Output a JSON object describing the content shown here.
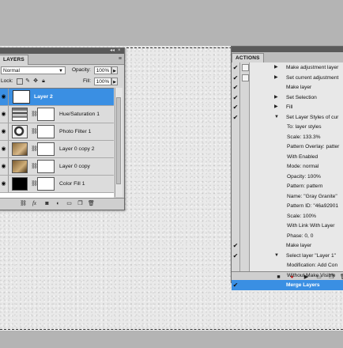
{
  "layers_panel": {
    "tab_label": "LAYERS",
    "blend_mode": "Normal",
    "opacity_label": "Opacity:",
    "opacity_value": "100%",
    "lock_label": "Lock:",
    "fill_label": "Fill:",
    "fill_value": "100%",
    "layers": [
      {
        "name": "Layer 2",
        "selected": true,
        "thumb": "white-fill"
      },
      {
        "name": "Hue/Saturation 1",
        "selected": false,
        "thumb": "adjustment"
      },
      {
        "name": "Photo Filter 1",
        "selected": false,
        "thumb": "adjustment"
      },
      {
        "name": "Layer 0 copy 2",
        "selected": false,
        "thumb": "photo"
      },
      {
        "name": "Layer 0 copy",
        "selected": false,
        "thumb": "photo"
      },
      {
        "name": "Color Fill 1",
        "selected": false,
        "thumb": "black-fill"
      }
    ]
  },
  "actions_panel": {
    "tab_label": "ACTIONS",
    "rows": [
      {
        "text": "Make adjustment layer",
        "checked": true,
        "box": true,
        "expand": "collapsed",
        "sub": false
      },
      {
        "text": "Set current adjustment",
        "checked": true,
        "box": true,
        "expand": "collapsed",
        "sub": false
      },
      {
        "text": "Make layer",
        "checked": true,
        "box": false,
        "expand": "none",
        "sub": false
      },
      {
        "text": "Set Selection",
        "checked": true,
        "box": false,
        "expand": "collapsed",
        "sub": false
      },
      {
        "text": "Fill",
        "checked": true,
        "box": false,
        "expand": "collapsed",
        "sub": false
      },
      {
        "text": "Set Layer Styles of cur",
        "checked": true,
        "box": false,
        "expand": "expanded",
        "sub": false
      },
      {
        "text": "To: layer styles",
        "sub": true
      },
      {
        "text": "Scale: 133.3%",
        "sub": true
      },
      {
        "text": "Pattern Overlay: patter",
        "sub": true
      },
      {
        "text": "With Enabled",
        "sub": true
      },
      {
        "text": "Mode: normal",
        "sub": true
      },
      {
        "text": "Opacity: 100%",
        "sub": true
      },
      {
        "text": "Pattern: pattern",
        "sub": true
      },
      {
        "text": "Name: \"Gray Granite\"",
        "sub": true
      },
      {
        "text": "Pattern ID: \"46a92901",
        "sub": true
      },
      {
        "text": "Scale: 100%",
        "sub": true
      },
      {
        "text": "With Link With Layer",
        "sub": true
      },
      {
        "text": "Phase: 0, 0",
        "sub": true
      },
      {
        "text": "Make layer",
        "checked": true,
        "box": false,
        "expand": "none",
        "sub": false
      },
      {
        "text": "Select layer \"Layer 1\"",
        "checked": true,
        "box": false,
        "expand": "expanded",
        "sub": false
      },
      {
        "text": "Modification: Add Con",
        "sub": true
      },
      {
        "text": "Without Make Visible",
        "sub": true
      },
      {
        "text": "Merge Layers",
        "checked": true,
        "box": false,
        "expand": "none",
        "sub": false,
        "highlighted": true
      }
    ]
  }
}
